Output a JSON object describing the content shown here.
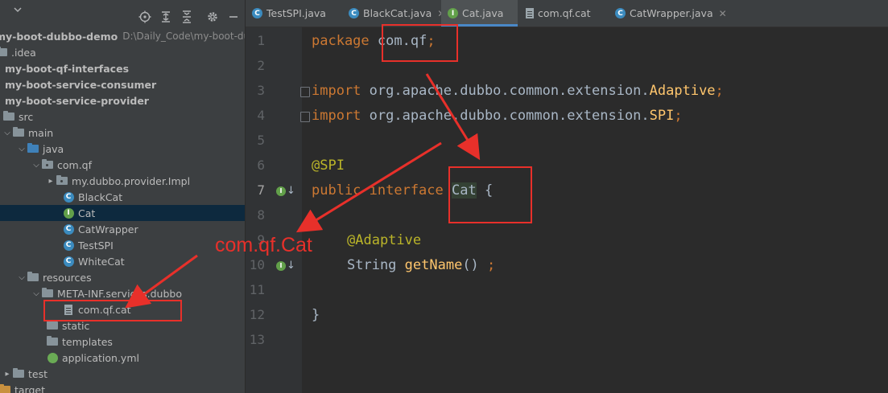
{
  "project_tree": {
    "project_name": "my-boot-dubbo-demo",
    "project_path": "D:\\Daily_Code\\my-boot-dubbo",
    "rows": [
      {
        "label": ".idea"
      },
      {
        "label": "my-boot-qf-interfaces"
      },
      {
        "label": "my-boot-service-consumer"
      },
      {
        "label": "my-boot-service-provider"
      },
      {
        "label": "src"
      },
      {
        "label": "main"
      },
      {
        "label": "java"
      },
      {
        "label": "com.qf"
      },
      {
        "label": "my.dubbo.provider.Impl"
      },
      {
        "label": "BlackCat"
      },
      {
        "label": "Cat"
      },
      {
        "label": "CatWrapper"
      },
      {
        "label": "TestSPI"
      },
      {
        "label": "WhiteCat"
      },
      {
        "label": "resources"
      },
      {
        "label": "META-INF.services.dubbo"
      },
      {
        "label": "com.qf.cat"
      },
      {
        "label": "static"
      },
      {
        "label": "templates"
      },
      {
        "label": "application.yml"
      },
      {
        "label": "test"
      },
      {
        "label": "target"
      }
    ]
  },
  "tabs": [
    {
      "label": "TestSPI.java",
      "icon": "class-run-icon"
    },
    {
      "label": "BlackCat.java",
      "icon": "class-icon"
    },
    {
      "label": "Cat.java",
      "icon": "interface-icon",
      "active": true
    },
    {
      "label": "com.qf.cat",
      "icon": "text-file-icon"
    },
    {
      "label": "CatWrapper.java",
      "icon": "class-icon"
    }
  ],
  "editor": {
    "line_numbers": [
      "1",
      "2",
      "3",
      "4",
      "5",
      "6",
      "7",
      "8",
      "9",
      "10",
      "11",
      "12",
      "13"
    ],
    "current_line": "7",
    "code": {
      "l1_kw": "package",
      "l1_pkg": " com.qf",
      "l1_semi": ";",
      "l3_kw": "import",
      "l3_path": " org.apache.dubbo.common.extension.",
      "l3_name": "Adaptive",
      "l3_semi": ";",
      "l4_kw": "import",
      "l4_path": " org.apache.dubbo.common.extension.",
      "l4_name": "SPI",
      "l4_semi": ";",
      "l6_ann": "@SPI",
      "l7_kw": "public interface",
      "l7_sp": " ",
      "l7_name": "Cat",
      "l7_brace": " {",
      "l9_ann": "@Adaptive",
      "l10_type": "String ",
      "l10_fn": "getName",
      "l10_paren": "() ",
      "l10_semi": ";",
      "l12_brace": "}"
    }
  },
  "annotation": {
    "label": "com.qf.Cat",
    "color": "#e8302a"
  },
  "colors": {
    "keyword": "#cc7832",
    "annotation": "#bbb529",
    "method": "#ffc66d",
    "plain": "#a9b7c6",
    "selection": "#0d293e",
    "panel_bg": "#3c3f41",
    "editor_bg": "#2b2b2b"
  }
}
